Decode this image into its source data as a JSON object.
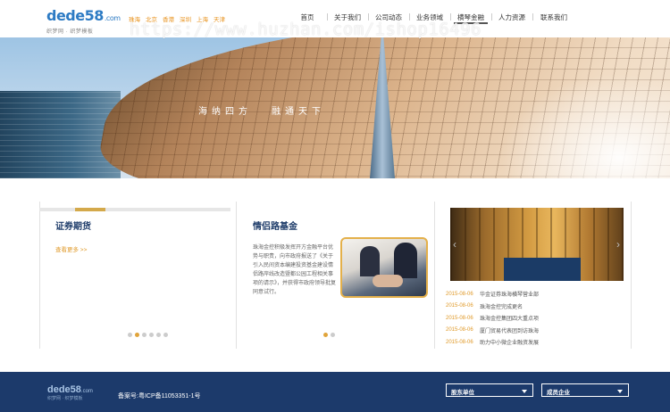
{
  "header": {
    "logo": {
      "text": "dede58",
      "tld": ".com",
      "tagline": "织梦网 · 织梦模板"
    },
    "cities": [
      "珠海",
      "北京",
      "香港",
      "深圳",
      "上海",
      "天津"
    ],
    "nav": [
      "首页",
      "关于我们",
      "公司动态",
      "业务领域",
      "横琴金融",
      "人力资源",
      "联系我们"
    ],
    "active_nav_index": 4
  },
  "banner": {
    "slogan_left": "海纳四方",
    "slogan_right": "融通天下"
  },
  "watermark": "https://www.huzhan.com/ishop16496",
  "section1": {
    "title": "证券期货",
    "more": "查看更多 >>",
    "progress_fraction": 0.16,
    "dots": 6,
    "active_dot": 1
  },
  "section2": {
    "title": "情侣路基金",
    "text": "珠海金控积极发挥开方金融平台优势与职责，向市政府报送了《关于引入民间资本编建投资基金建设情侣路岸线改造暨都公园工程相关事项的请示》，并获得市政府领导批复同意试行。",
    "dots": 2,
    "active_dot": 0
  },
  "section3": {
    "prev": "‹",
    "next": "›",
    "news": [
      {
        "date": "2015-08-06",
        "title": "华金证券珠海横琴营业部"
      },
      {
        "date": "2015-08-06",
        "title": "珠海金控完成更名"
      },
      {
        "date": "2015-08-06",
        "title": "珠海金控集团四大重点项"
      },
      {
        "date": "2015-08-06",
        "title": "厦门贸易代表团到访珠海"
      },
      {
        "date": "2015-08-06",
        "title": "助力中小微企业融资发展"
      }
    ]
  },
  "footer": {
    "logo": {
      "text": "dede58",
      "tld": ".com",
      "tagline": "织梦网 · 织梦模板"
    },
    "icp": "备案号:粤ICP备11053351-1号",
    "select1": "股东单位",
    "select2": "成员企业"
  },
  "colors": {
    "accent": "#e0a43b",
    "navy": "#1c3a6b",
    "title": "#1e3c6a"
  }
}
